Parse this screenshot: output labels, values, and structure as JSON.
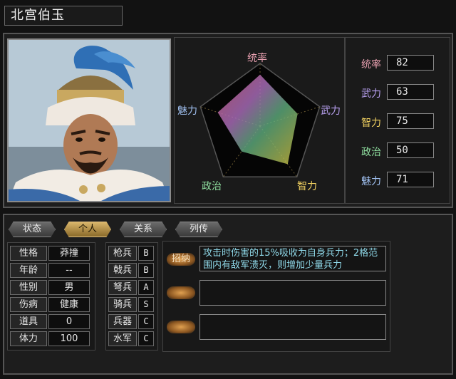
{
  "character": {
    "name": "北宫伯玉"
  },
  "radar": {
    "labels": {
      "leadership": "统率",
      "war": "武力",
      "intel": "智力",
      "politics": "政治",
      "charm": "魅力"
    },
    "values": {
      "leadership": 82,
      "war": 63,
      "intel": 75,
      "politics": 50,
      "charm": 71
    },
    "max": 100
  },
  "stats": [
    {
      "label": "统率",
      "value": "82",
      "color": "#e8a0b0"
    },
    {
      "label": "武力",
      "value": "63",
      "color": "#b8a0f0"
    },
    {
      "label": "智力",
      "value": "75",
      "color": "#f0d060"
    },
    {
      "label": "政治",
      "value": "50",
      "color": "#90e0a0"
    },
    {
      "label": "魅力",
      "value": "71",
      "color": "#a0c0f0"
    }
  ],
  "tabs": [
    {
      "label": "状态"
    },
    {
      "label": "个人"
    },
    {
      "label": "关系"
    },
    {
      "label": "列传"
    }
  ],
  "personal": [
    {
      "label": "性格",
      "value": "莽撞"
    },
    {
      "label": "年龄",
      "value": "--"
    },
    {
      "label": "性别",
      "value": "男"
    },
    {
      "label": "伤病",
      "value": "健康"
    },
    {
      "label": "道具",
      "value": "0"
    },
    {
      "label": "体力",
      "value": "100"
    }
  ],
  "aptitudes": [
    {
      "label": "枪兵",
      "grade": "B"
    },
    {
      "label": "戟兵",
      "grade": "B"
    },
    {
      "label": "弩兵",
      "grade": "A"
    },
    {
      "label": "骑兵",
      "grade": "S"
    },
    {
      "label": "兵器",
      "grade": "C"
    },
    {
      "label": "水军",
      "grade": "C"
    }
  ],
  "skills": {
    "button_label": "招纳",
    "slot1": "攻击时伤害的15%吸收为自身兵力；2格范围内有敌军溃灭，则增加少量兵力",
    "slot2": "",
    "slot3": ""
  }
}
